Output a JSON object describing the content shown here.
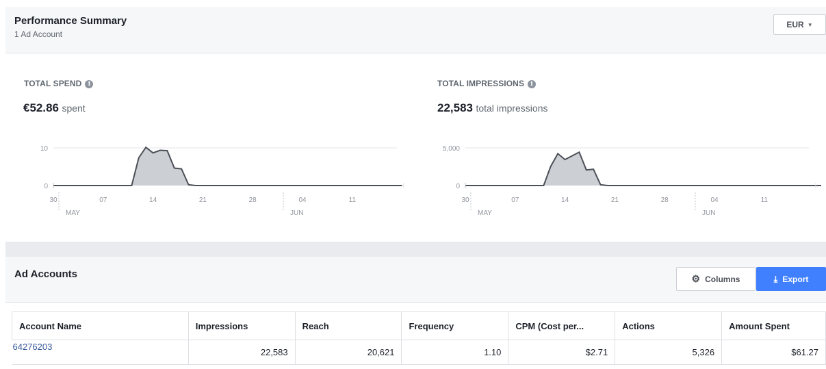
{
  "header": {
    "title": "Performance Summary",
    "subtitle": "1 Ad Account",
    "currency_label": "EUR"
  },
  "spend": {
    "label": "TOTAL SPEND",
    "value": "€52.86",
    "suffix": "spent"
  },
  "impressions": {
    "label": "TOTAL IMPRESSIONS",
    "value": "22,583",
    "suffix": "total impressions"
  },
  "chart_data": [
    {
      "type": "area",
      "title": "",
      "x_tick_labels": [
        "30",
        "07",
        "14",
        "21",
        "28",
        "04",
        "11"
      ],
      "month_labels": [
        "MAY",
        "JUN"
      ],
      "y_tick_labels": [
        "0",
        "10"
      ],
      "ylim": [
        0,
        12
      ],
      "x": [
        "2018-04-30",
        "2018-05-01",
        "2018-05-02",
        "2018-05-03",
        "2018-05-04",
        "2018-05-05",
        "2018-05-06",
        "2018-05-07",
        "2018-05-08",
        "2018-05-09",
        "2018-05-10",
        "2018-05-11",
        "2018-05-12",
        "2018-05-13",
        "2018-05-14",
        "2018-05-15",
        "2018-05-16",
        "2018-05-17",
        "2018-05-18",
        "2018-05-19",
        "2018-05-20",
        "2018-05-21",
        "2018-05-22",
        "2018-05-23",
        "2018-05-24",
        "2018-05-25",
        "2018-05-26",
        "2018-05-27",
        "2018-05-28",
        "2018-05-29",
        "2018-05-30",
        "2018-05-31",
        "2018-06-01",
        "2018-06-02",
        "2018-06-03",
        "2018-06-04",
        "2018-06-05",
        "2018-06-06",
        "2018-06-07",
        "2018-06-08",
        "2018-06-09",
        "2018-06-10",
        "2018-06-11",
        "2018-06-12",
        "2018-06-13",
        "2018-06-14",
        "2018-06-15",
        "2018-06-16",
        "2018-06-17",
        "2018-06-18"
      ],
      "values": [
        0,
        0,
        0,
        0,
        0,
        0,
        0,
        0,
        0,
        0,
        0,
        0,
        7.5,
        10.3,
        8.8,
        9.5,
        9.4,
        4.7,
        4.5,
        0.2,
        0,
        0,
        0,
        0,
        0,
        0,
        0,
        0,
        0,
        0,
        0,
        0,
        0,
        0,
        0,
        0,
        0,
        0,
        0,
        0,
        0,
        0,
        0,
        0,
        0,
        0,
        0,
        0,
        0,
        0
      ]
    },
    {
      "type": "area",
      "title": "",
      "x_tick_labels": [
        "30",
        "07",
        "14",
        "21",
        "28",
        "04",
        "11"
      ],
      "month_labels": [
        "MAY",
        "JUN"
      ],
      "y_tick_labels": [
        "0",
        "5,000"
      ],
      "ylim": [
        0,
        6000
      ],
      "x": [
        "2018-04-30",
        "2018-05-01",
        "2018-05-02",
        "2018-05-03",
        "2018-05-04",
        "2018-05-05",
        "2018-05-06",
        "2018-05-07",
        "2018-05-08",
        "2018-05-09",
        "2018-05-10",
        "2018-05-11",
        "2018-05-12",
        "2018-05-13",
        "2018-05-14",
        "2018-05-15",
        "2018-05-16",
        "2018-05-17",
        "2018-05-18",
        "2018-05-19",
        "2018-05-20",
        "2018-05-21",
        "2018-05-22",
        "2018-05-23",
        "2018-05-24",
        "2018-05-25",
        "2018-05-26",
        "2018-05-27",
        "2018-05-28",
        "2018-05-29",
        "2018-05-30",
        "2018-05-31",
        "2018-06-01",
        "2018-06-02",
        "2018-06-03",
        "2018-06-04",
        "2018-06-05",
        "2018-06-06",
        "2018-06-07",
        "2018-06-08",
        "2018-06-09",
        "2018-06-10",
        "2018-06-11",
        "2018-06-12",
        "2018-06-13",
        "2018-06-14",
        "2018-06-15",
        "2018-06-16",
        "2018-06-17",
        "2018-06-18"
      ],
      "values": [
        0,
        0,
        0,
        0,
        0,
        0,
        0,
        0,
        0,
        0,
        0,
        0,
        2600,
        4300,
        3500,
        4000,
        4500,
        2100,
        2200,
        100,
        0,
        0,
        0,
        0,
        0,
        0,
        0,
        0,
        0,
        0,
        0,
        0,
        0,
        0,
        0,
        0,
        0,
        0,
        0,
        0,
        0,
        0,
        0,
        0,
        0,
        0,
        0,
        0,
        0,
        0,
        0
      ]
    }
  ],
  "accounts": {
    "title": "Ad Accounts",
    "columns_label": "Columns",
    "export_label": "Export",
    "headers": [
      "Account Name",
      "Impressions",
      "Reach",
      "Frequency",
      "CPM (Cost per...",
      "Actions",
      "Amount Spent"
    ],
    "rows": [
      [
        "64276203",
        "22,583",
        "20,621",
        "1.10",
        "$2.71",
        "5,326",
        "$61.27"
      ]
    ]
  },
  "colors": {
    "panel_bg": "#f6f7f9",
    "link": "#365899",
    "export_bg": "#4080ff",
    "chart_line": "#4b4f56",
    "chart_fill": "#ccd0d5"
  }
}
